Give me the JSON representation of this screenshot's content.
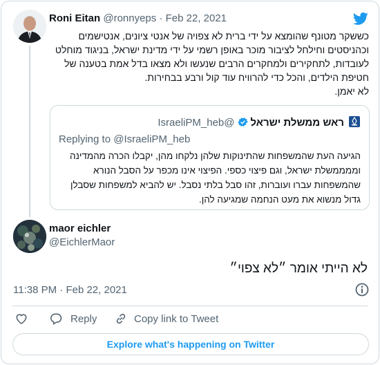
{
  "colors": {
    "accent": "#1d9bf0",
    "muted": "#536471",
    "border": "#cfd9de",
    "text": "#0f1419"
  },
  "icons": {
    "brand": "twitter-bird-icon",
    "verified": "verified-badge-icon",
    "info": "info-icon",
    "like": "heart-icon",
    "reply": "speech-bubble-icon",
    "copy": "link-icon",
    "flag": "emblem-icon"
  },
  "parent": {
    "name": "Roni Eitan",
    "handle": "@ronnyeps",
    "separator": "·",
    "date": "Feb 22, 2021",
    "text": "כששקר מטונף שהומצא על ידי ברית לא צפויה של אנטי ציונים, אנטישמים וכהניסטים וחילחל לציבור מוכר באופן רשמי על ידי מדינת ישראל, בניגוד מוחלט לעובדות, לתחקירים ולמחקרים הרבים שנעשו ולא מצאו בדל אמת בטענה של חטיפת הילדים, והכל כדי להרוויח עוד קול ורבע בבחירות.",
    "closing": "לא יאמן."
  },
  "quote": {
    "name": "ראש ממשלת ישראל",
    "handle": "@IsraeliPM_heb",
    "replying_prefix": "Replying to",
    "replying_to": "@IsraeliPM_heb",
    "text": "הגיעה העת שהמשפחות שהתינוקות שלהן נלקחו מהן, יקבלו הכרה מהמדינה וממממשלת ישראל, וגם פיצוי כספי. הפיצוי אינו מכפר על הסבל הנורא שהמשפחות עברו ועוברות, זהו סבל בלתי נסבל. יש להביא למשפחות שסבלן גדול מנשוא את מעט הנחמה שמגיעה להן."
  },
  "tweet": {
    "name": "maor eichler",
    "handle": "@EichlerMaor",
    "text": "לא הייתי אומר ״לא צפוי״",
    "time": "11:38 PM",
    "separator": "·",
    "date": "Feb 22, 2021"
  },
  "actions": {
    "reply_label": "Reply",
    "copy_label": "Copy link to Tweet"
  },
  "explore_label": "Explore what's happening on Twitter"
}
